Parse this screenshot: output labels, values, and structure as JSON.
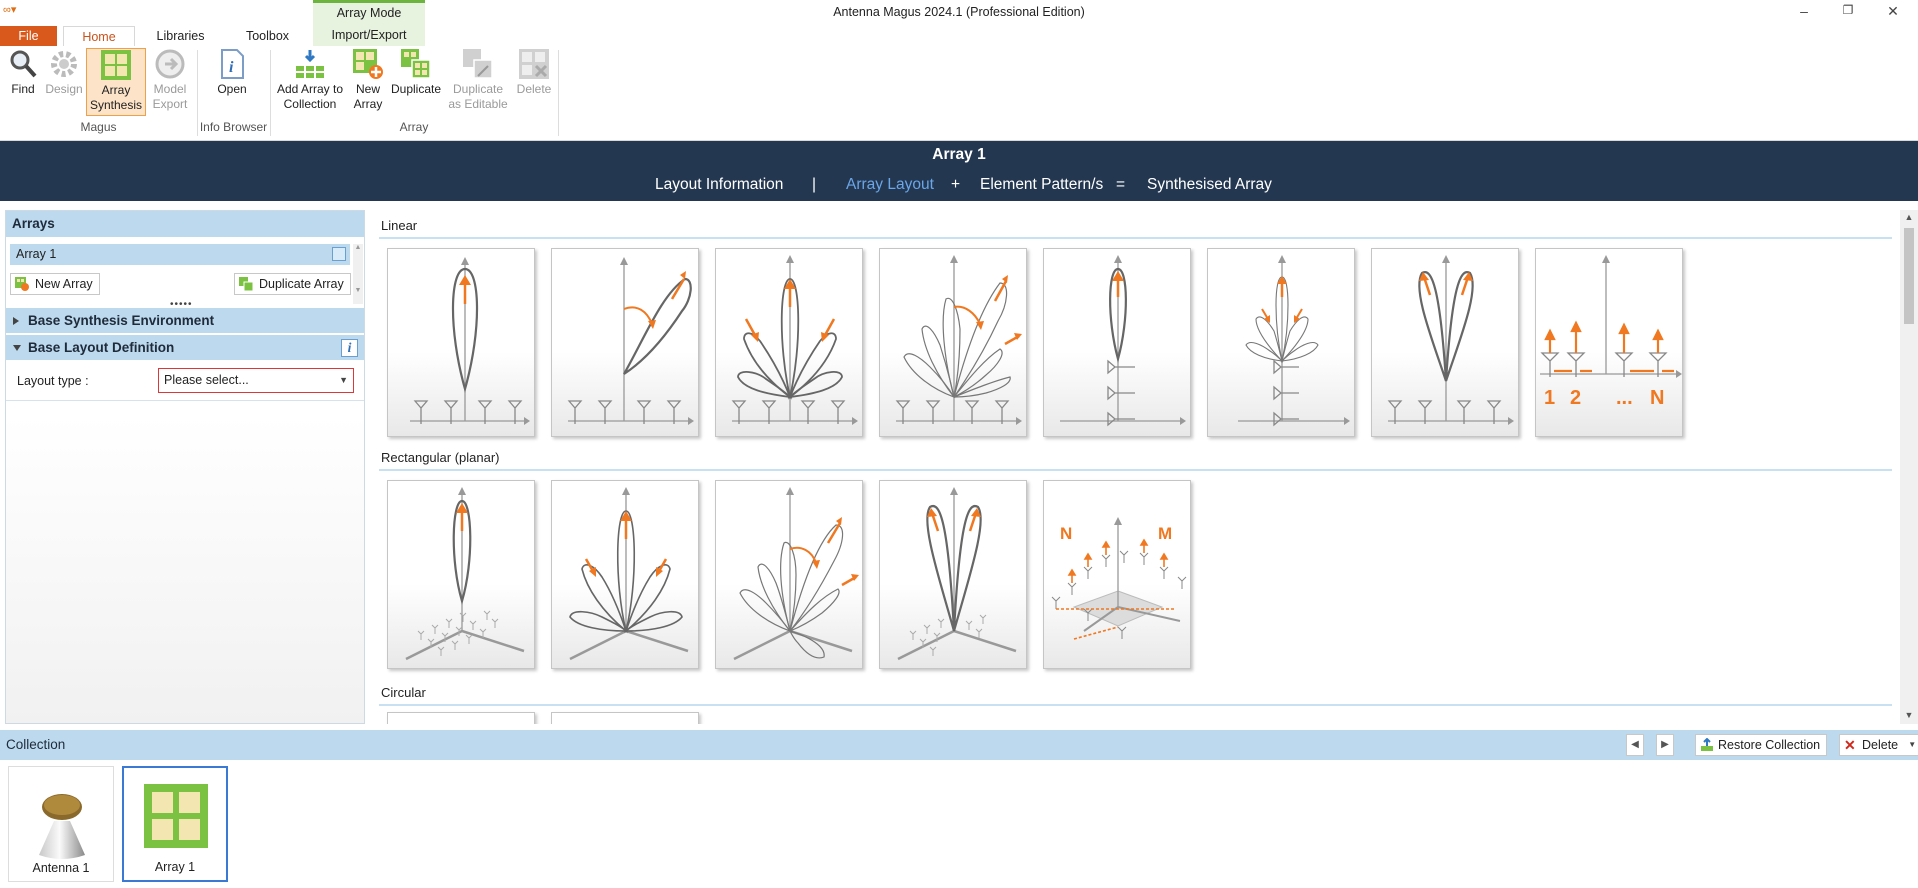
{
  "window": {
    "title": "Antenna Magus 2024.1 (Professional Edition)",
    "minimize": "–",
    "restore": "❐",
    "close": "✕"
  },
  "ribbon_tabs": {
    "file": "File",
    "home": "Home",
    "libraries": "Libraries",
    "toolbox": "Toolbox",
    "mode_label": "Array Mode",
    "import_export": "Import/Export"
  },
  "ribbon": {
    "find": "Find",
    "design": "Design",
    "array_synthesis_1": "Array",
    "array_synthesis_2": "Synthesis",
    "model_export_1": "Model",
    "model_export_2": "Export",
    "open": "Open",
    "add_array_1": "Add Array to",
    "add_array_2": "Collection",
    "new_array_1": "New",
    "new_array_2": "Array",
    "duplicate": "Duplicate",
    "dup_editable_1": "Duplicate",
    "dup_editable_2": "as Editable",
    "delete": "Delete",
    "group_magus": "Magus",
    "group_info": "Info Browser",
    "group_array": "Array"
  },
  "banner": {
    "title": "Array 1",
    "layout_info": "Layout Information",
    "divider": "|",
    "array_layout": "Array Layout",
    "plus": "+",
    "element_patterns": "Element Pattern/s",
    "equals": "=",
    "synthesised_array": "Synthesised Array",
    "active_color": "#6aa6e8"
  },
  "left": {
    "arrays_header": "Arrays",
    "array_item": "Array 1",
    "new_array": "New Array",
    "duplicate_array": "Duplicate Array",
    "base_synthesis": "Base Synthesis Environment",
    "base_layout": "Base Layout Definition",
    "layout_type_label": "Layout type :",
    "layout_type_value": "Please select..."
  },
  "sections": {
    "linear": "Linear",
    "rectangular": "Rectangular (planar)",
    "circular": "Circular"
  },
  "card_labels": {
    "one": "1",
    "two": "2",
    "dots": "...",
    "n": "N",
    "rect_n": "N",
    "rect_m": "M"
  },
  "collection": {
    "title": "Collection",
    "restore": "Restore Collection",
    "delete": "Delete",
    "items": [
      {
        "label": "Antenna 1"
      },
      {
        "label": "Array 1"
      }
    ]
  },
  "colors": {
    "accent_orange": "#f07820",
    "banner": "#243750",
    "panel_blue": "#bcd9ee",
    "selected_green": "#7cc242"
  }
}
